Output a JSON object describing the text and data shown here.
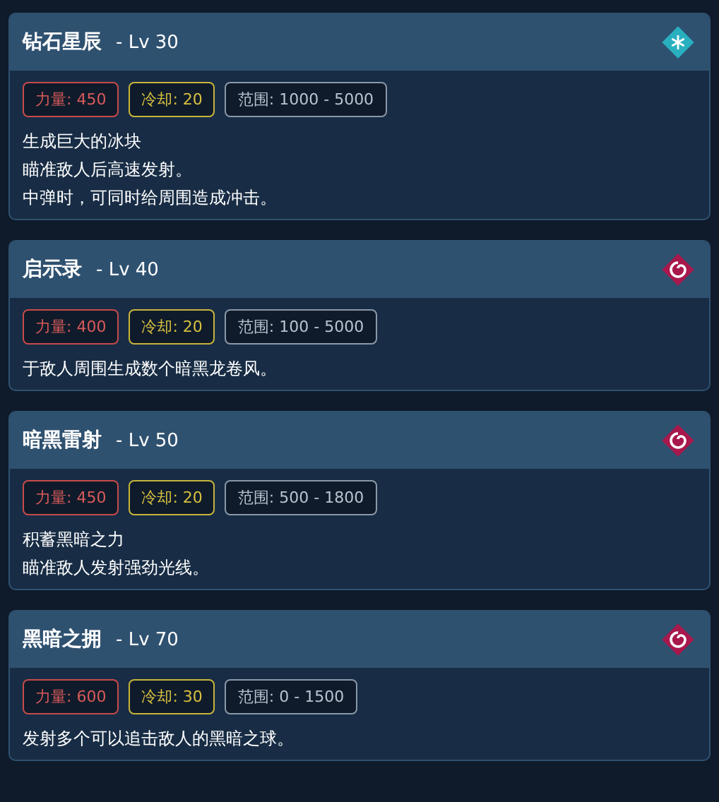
{
  "skills": [
    {
      "name": "钻石星辰",
      "level": "- Lv 30",
      "kind": "ice",
      "stats": [
        {
          "kind": "power",
          "text": "力量: 450"
        },
        {
          "kind": "cooldown",
          "text": "冷却: 20"
        },
        {
          "kind": "range",
          "text": "范围: 1000 - 5000"
        }
      ],
      "description": [
        "生成巨大的冰块",
        "瞄准敌人后高速发射。",
        "中弹时，可同时给周围造成冲击。"
      ]
    },
    {
      "name": "启示录",
      "level": "- Lv 40",
      "kind": "dark",
      "stats": [
        {
          "kind": "power",
          "text": "力量: 400"
        },
        {
          "kind": "cooldown",
          "text": "冷却: 20"
        },
        {
          "kind": "range",
          "text": "范围: 100 - 5000"
        }
      ],
      "description": [
        "于敌人周围生成数个暗黑龙卷风。"
      ]
    },
    {
      "name": "暗黑雷射",
      "level": "- Lv 50",
      "kind": "dark",
      "stats": [
        {
          "kind": "power",
          "text": "力量: 450"
        },
        {
          "kind": "cooldown",
          "text": "冷却: 20"
        },
        {
          "kind": "range",
          "text": "范围: 500 - 1800"
        }
      ],
      "description": [
        "积蓄黑暗之力",
        "瞄准敌人发射强劲光线。"
      ]
    },
    {
      "name": "黑暗之拥",
      "level": "- Lv 70",
      "kind": "dark",
      "stats": [
        {
          "kind": "power",
          "text": "力量: 600"
        },
        {
          "kind": "cooldown",
          "text": "冷却: 30"
        },
        {
          "kind": "range",
          "text": "范围: 0 - 1500"
        }
      ],
      "description": [
        "发射多个可以追击敌人的黑暗之球。"
      ]
    }
  ]
}
